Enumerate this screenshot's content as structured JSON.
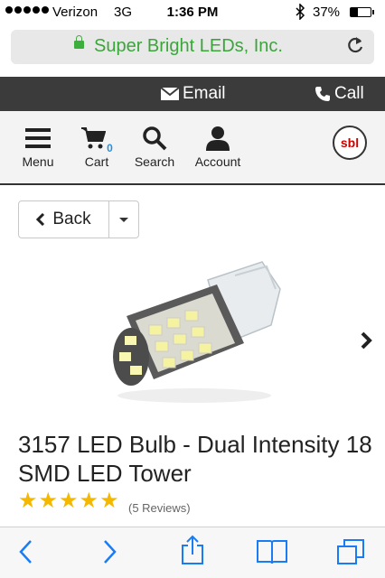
{
  "status_bar": {
    "carrier": "Verizon",
    "network": "3G",
    "time": "1:36 PM",
    "battery_percent": "37%",
    "battery_level": 0.37
  },
  "url_bar": {
    "site_name": "Super Bright LEDs, Inc."
  },
  "contact_bar": {
    "email_label": "Email",
    "call_label": "Call"
  },
  "nav": {
    "menu_label": "Menu",
    "cart_label": "Cart",
    "cart_count": "0",
    "search_label": "Search",
    "account_label": "Account",
    "logo_text": "sbl"
  },
  "back_button": {
    "label": "Back"
  },
  "product": {
    "title": "3157 LED Bulb - Dual Intensity 18 SMD LED Tower",
    "rating": 5,
    "reviews": "(5 Reviews)"
  },
  "colors": {
    "url_green": "#3aa63a",
    "contact_bar_bg": "#3b3b3b",
    "ios_blue": "#1a7cf5",
    "star_gold": "#f5b800",
    "cart_badge": "#2a8fd6"
  }
}
